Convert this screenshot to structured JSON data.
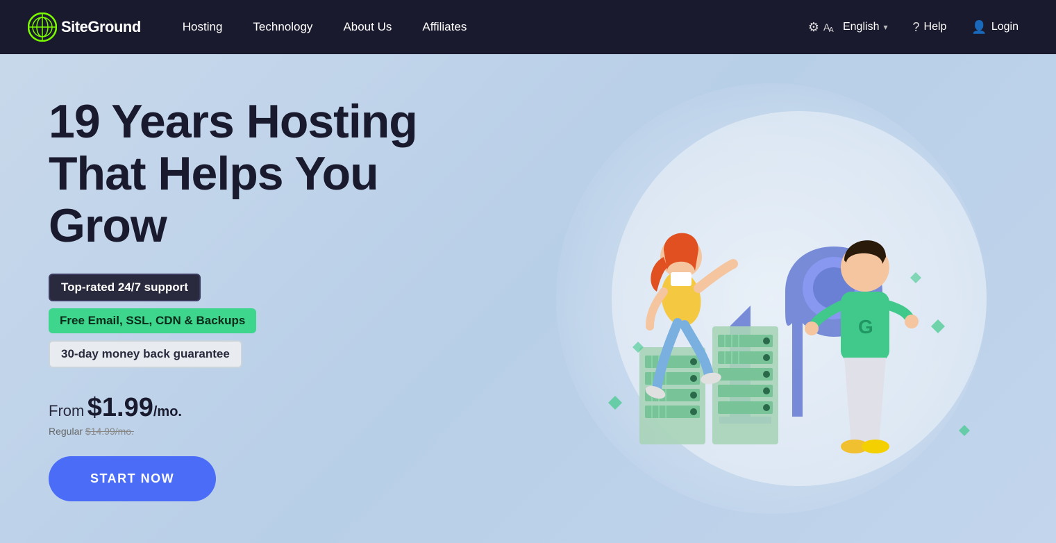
{
  "nav": {
    "logo_text": "SiteGround",
    "links": [
      {
        "label": "Hosting",
        "id": "hosting"
      },
      {
        "label": "Technology",
        "id": "technology"
      },
      {
        "label": "About Us",
        "id": "about-us"
      },
      {
        "label": "Affiliates",
        "id": "affiliates"
      }
    ],
    "right": {
      "language": "English",
      "language_icon": "🌐",
      "chevron": "▾",
      "help": "Help",
      "login": "Login"
    }
  },
  "hero": {
    "title_line1": "19 Years Hosting",
    "title_line2": "That Helps You Grow",
    "badges": [
      {
        "text": "Top-rated 24/7 support",
        "type": "dark"
      },
      {
        "text": "Free Email, SSL, CDN & Backups",
        "type": "green"
      },
      {
        "text": "30-day money back guarantee",
        "type": "gray"
      }
    ],
    "price_from": "From",
    "price_main": "$1.99",
    "price_per": "/mo.",
    "price_regular_label": "Regular",
    "price_regular_value": "$14.99/mo.",
    "cta_button": "START NOW"
  }
}
